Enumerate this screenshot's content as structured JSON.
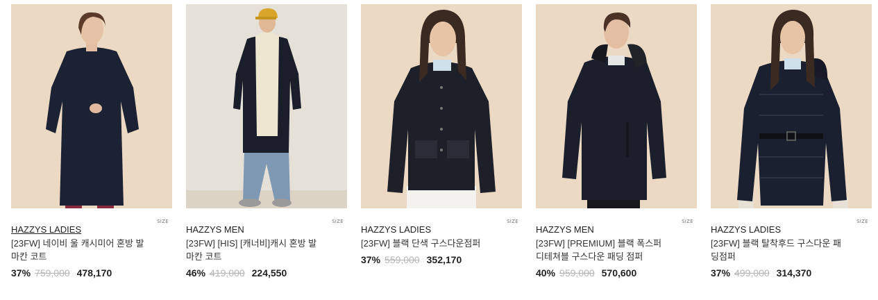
{
  "size_label": "SIZE",
  "products": [
    {
      "brand": "HAZZYS LADIES",
      "name_line1": "[23FW] 네이비 울 캐시미어 혼방 발",
      "name_line2": "마칸 코트",
      "discount": "37%",
      "original_price": "759,000",
      "sale_price": "478,170"
    },
    {
      "brand": "HAZZYS MEN",
      "name_line1": "[23FW] [HIS] [캐너비]캐시 혼방 발",
      "name_line2": "마칸 코트",
      "discount": "46%",
      "original_price": "419,000",
      "sale_price": "224,550"
    },
    {
      "brand": "HAZZYS LADIES",
      "name_line1": "[23FW] 블랙 단색 구스다운점퍼",
      "name_line2": "",
      "discount": "37%",
      "original_price": "559,000",
      "sale_price": "352,170"
    },
    {
      "brand": "HAZZYS MEN",
      "name_line1": "[23FW] [PREMIUM] 블랙 폭스퍼",
      "name_line2": "디테쳐블 구스다운 패딩 점퍼",
      "discount": "40%",
      "original_price": "959,000",
      "sale_price": "570,600"
    },
    {
      "brand": "HAZZYS LADIES",
      "name_line1": "[23FW] 블랙 탈착후드 구스다운 패",
      "name_line2": "딩점퍼",
      "discount": "37%",
      "original_price": "499,000",
      "sale_price": "314,370"
    }
  ],
  "colors": {
    "bg_warm": "#ecd9c4",
    "bg_cool": "#e4dccf",
    "navy": "#1c2233",
    "black": "#1a1c22",
    "strike": "#b5b5b5"
  }
}
